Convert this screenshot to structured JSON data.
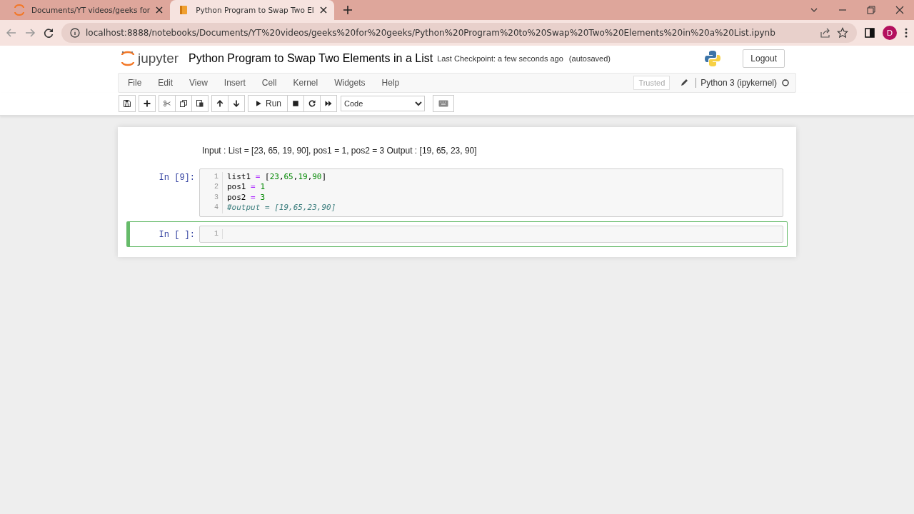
{
  "browser": {
    "tabs": [
      {
        "title": "Documents/YT videos/geeks for",
        "selected": false
      },
      {
        "title": "Python Program to Swap Two El",
        "selected": true
      }
    ],
    "address": "localhost:8888/notebooks/Documents/YT%20videos/geeks%20for%20geeks/Python%20Program%20to%20Swap%20Two%20Elements%20in%20a%20List.ipynb",
    "profile_initial": "D"
  },
  "header": {
    "logo_text": "jupyter",
    "notebook_title": "Python Program to Swap Two Elements in a List",
    "checkpoint": "Last Checkpoint: a few seconds ago",
    "autosave": "(autosaved)",
    "logout": "Logout"
  },
  "menu": {
    "items": [
      "File",
      "Edit",
      "View",
      "Insert",
      "Cell",
      "Kernel",
      "Widgets",
      "Help"
    ],
    "trusted": "Trusted",
    "kernel": "Python 3 (ipykernel)",
    "kernel_busy": false
  },
  "toolbar": {
    "buttons": [
      {
        "kind": "save"
      },
      {
        "kind": "add"
      },
      {
        "kind": "cut"
      },
      {
        "kind": "copy"
      },
      {
        "kind": "paste"
      },
      {
        "kind": "up"
      },
      {
        "kind": "down"
      },
      {
        "kind": "run",
        "label": "Run"
      },
      {
        "kind": "stop"
      },
      {
        "kind": "restart"
      },
      {
        "kind": "fast_forward"
      }
    ],
    "cell_type": "Code"
  },
  "cells": [
    {
      "kind": "markdown",
      "text": "Input : List = [23, 65, 19, 90], pos1 = 1, pos2 = 3 Output : [19, 65, 23, 90]",
      "selected": false
    },
    {
      "kind": "code",
      "prompt": "In [9]:",
      "selected": false,
      "lines": [
        {
          "number": "1",
          "tokens": [
            {
              "t": "list1",
              "kind": "name"
            },
            {
              "t": "=",
              "kind": "op"
            },
            {
              "t": "[",
              "kind": "punct"
            },
            {
              "t": "23",
              "kind": "num"
            },
            {
              "t": ",",
              "kind": "punct"
            },
            {
              "t": "65",
              "kind": "num"
            },
            {
              "t": ",",
              "kind": "punct"
            },
            {
              "t": "19",
              "kind": "num"
            },
            {
              "t": ",",
              "kind": "punct"
            },
            {
              "t": "90",
              "kind": "num"
            },
            {
              "t": "]",
              "kind": "punct"
            }
          ]
        },
        {
          "number": "2",
          "tokens": [
            {
              "t": "pos1",
              "kind": "name"
            },
            {
              "t": "=",
              "kind": "op"
            },
            {
              "t": "1",
              "kind": "num"
            }
          ]
        },
        {
          "number": "3",
          "tokens": [
            {
              "t": "pos2",
              "kind": "name"
            },
            {
              "t": "=",
              "kind": "op"
            },
            {
              "t": "3",
              "kind": "num"
            }
          ]
        },
        {
          "number": "4",
          "tokens": [
            {
              "t": "#output = [19,65,23,90]",
              "kind": "comment"
            }
          ]
        }
      ]
    },
    {
      "kind": "code",
      "prompt": "In [ ]:",
      "selected": true,
      "lines": [
        {
          "number": "1"
        }
      ]
    }
  ]
}
